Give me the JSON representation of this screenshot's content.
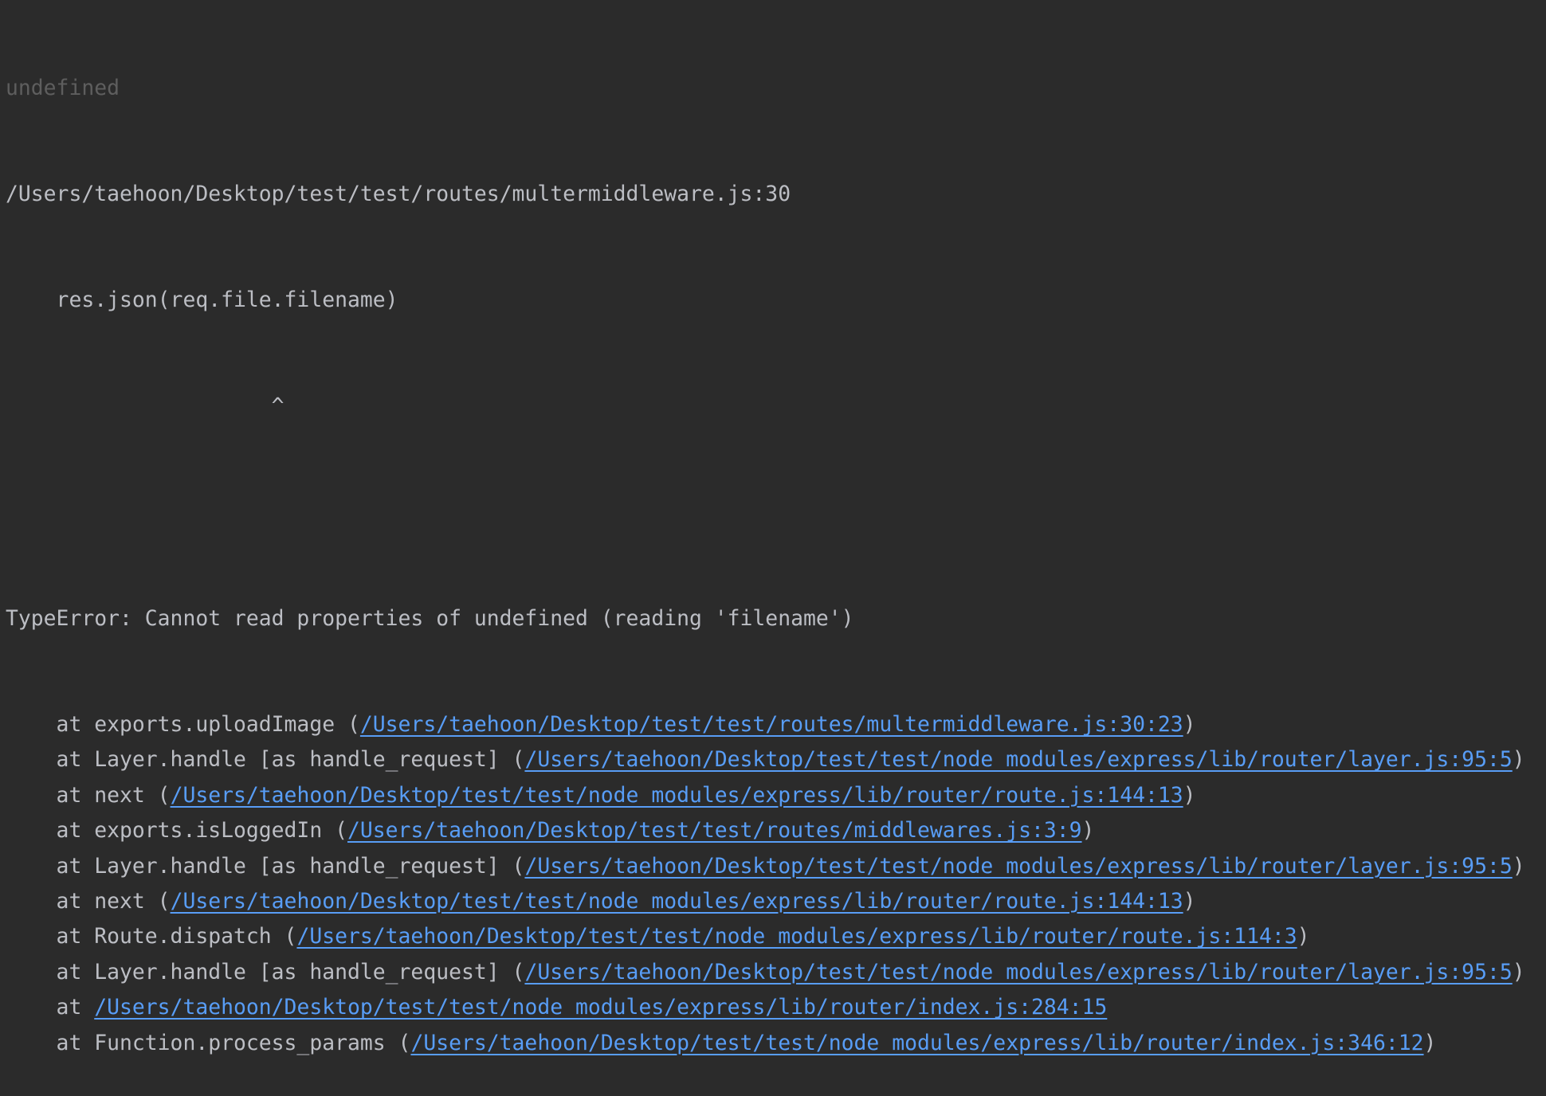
{
  "console": {
    "undefined_line": "undefined",
    "source_location": "/Users/taehoon/Desktop/test/test/routes/multermiddleware.js:30",
    "source_code": "    res.json(req.file.filename)",
    "caret": "                     ^",
    "blank": "",
    "error_message": "TypeError: Cannot read properties of undefined (reading 'filename')",
    "stack": [
      {
        "prefix": "    at exports.uploadImage (",
        "link": "/Users/taehoon/Desktop/test/test/routes/multermiddleware.js:30:23",
        "suffix": ")"
      },
      {
        "prefix": "    at Layer.handle [as handle_request] (",
        "link": "/Users/taehoon/Desktop/test/test/node_modules/express/lib/router/layer.js:95:5",
        "suffix": ")"
      },
      {
        "prefix": "    at next (",
        "link": "/Users/taehoon/Desktop/test/test/node_modules/express/lib/router/route.js:144:13",
        "suffix": ")"
      },
      {
        "prefix": "    at exports.isLoggedIn (",
        "link": "/Users/taehoon/Desktop/test/test/routes/middlewares.js:3:9",
        "suffix": ")"
      },
      {
        "prefix": "    at Layer.handle [as handle_request] (",
        "link": "/Users/taehoon/Desktop/test/test/node_modules/express/lib/router/layer.js:95:5",
        "suffix": ")"
      },
      {
        "prefix": "    at next (",
        "link": "/Users/taehoon/Desktop/test/test/node_modules/express/lib/router/route.js:144:13",
        "suffix": ")"
      },
      {
        "prefix": "    at Route.dispatch (",
        "link": "/Users/taehoon/Desktop/test/test/node_modules/express/lib/router/route.js:114:3",
        "suffix": ")"
      },
      {
        "prefix": "    at Layer.handle [as handle_request] (",
        "link": "/Users/taehoon/Desktop/test/test/node_modules/express/lib/router/layer.js:95:5",
        "suffix": ")"
      },
      {
        "prefix": "    at ",
        "link": "/Users/taehoon/Desktop/test/test/node_modules/express/lib/router/index.js:284:15",
        "suffix": ""
      },
      {
        "prefix": "    at Function.process_params (",
        "link": "/Users/taehoon/Desktop/test/test/node_modules/express/lib/router/index.js:346:12",
        "suffix": ")"
      }
    ]
  }
}
